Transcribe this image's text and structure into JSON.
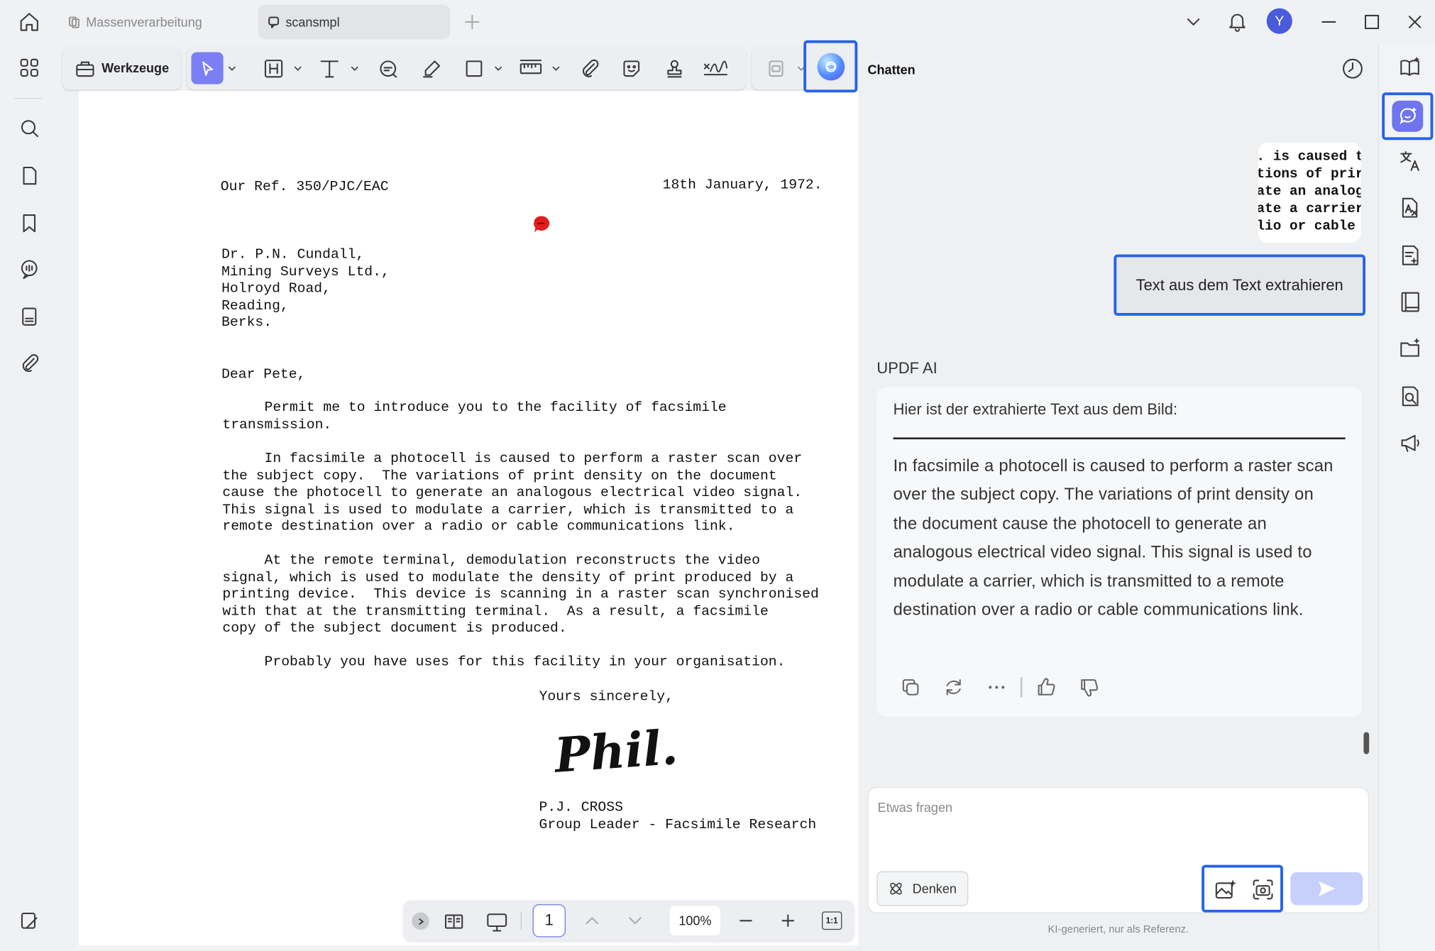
{
  "titlebar": {
    "tabs": [
      {
        "label": "Massenverarbeitung"
      },
      {
        "label": "scansmpl"
      }
    ],
    "avatar_letter": "Y"
  },
  "toolbar": {
    "tools_label": "Werkzeuge"
  },
  "document": {
    "ref": "Our Ref. 350/PJC/EAC",
    "date": "18th January, 1972.",
    "address": [
      "Dr. P.N. Cundall,",
      "Mining Surveys Ltd.,",
      "Holroyd Road,",
      "Reading,",
      "Berks."
    ],
    "salutation": "Dear Pete,",
    "para1": [
      "     Permit me to introduce you to the facility of facsimile",
      "transmission."
    ],
    "para2": [
      "     In facsimile a photocell is caused to perform a raster scan over",
      "the subject copy.  The variations of print density on the document",
      "cause the photocell to generate an analogous electrical video signal.",
      "This signal is used to modulate a carrier, which is transmitted to a",
      "remote destination over a radio or cable communications link."
    ],
    "para3": [
      "     At the remote terminal, demodulation reconstructs the video",
      "signal, which is used to modulate the density of print produced by a",
      "printing device.  This device is scanning in a raster scan synchronised",
      "with that at the transmitting terminal.  As a result, a facsimile",
      "copy of the subject document is produced."
    ],
    "para4": "     Probably you have uses for this facility in your organisation.",
    "closing": "Yours sincerely,",
    "signature": "Phil.",
    "signer_name": "P.J. CROSS",
    "signer_title": "Group Leader - Facsimile Research"
  },
  "nav": {
    "page": "1",
    "zoom": "100%",
    "fit_label": "1:1"
  },
  "chat": {
    "title": "Chatten",
    "image_snippet": [
      ". is caused t",
      "tions of prir",
      "ate an analog",
      "ate a carrier",
      "lio or cable"
    ],
    "user_message": "Text aus dem Text extrahieren",
    "ai_label": "UPDF AI",
    "ai_intro": "Hier ist der extrahierte Text aus dem Bild:",
    "ai_body": "In facsimile a photocell is caused to perform a raster scan over the subject copy. The variations of print density on the document cause the photocell to generate an analogous electrical video signal. This signal is used to modulate a carrier, which is transmitted to a remote destination over a radio or cable communications link.",
    "input_placeholder": "Etwas fragen",
    "think_label": "Denken",
    "disclaimer": "KI-generiert, nur als Referenz."
  },
  "colors": {
    "accent": "#2563eb",
    "tool_active": "#7b7ff5",
    "comment_marker": "#e11d1d"
  }
}
